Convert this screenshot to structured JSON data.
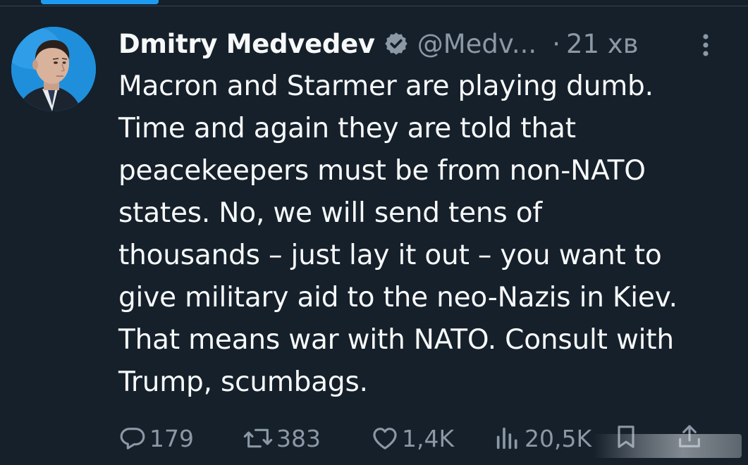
{
  "tweet": {
    "author": {
      "display_name": "Dmitry Medvedev",
      "handle": "@Medv...",
      "verified": true,
      "avatar_icon": "avatar-portrait"
    },
    "separator": "·",
    "time": "21 хв",
    "more_icon": "more-vertical-icon",
    "text": "Macron and Starmer are playing dumb.\nTime and again they are told that\npeacekeepers must be from non-NATO\nstates. No, we will send tens of\nthousands – just lay it out – you want to\ngive military aid to the neo-Nazis in Kiev.\nThat means war with NATO. Consult with\nTrump, scumbags.",
    "actions": {
      "reply": {
        "icon": "reply-icon",
        "count": "179"
      },
      "retweet": {
        "icon": "retweet-icon",
        "count": "383"
      },
      "like": {
        "icon": "heart-icon",
        "count": "1,4K"
      },
      "views": {
        "icon": "views-icon",
        "count": "20,5K"
      },
      "bookmark": {
        "icon": "bookmark-icon"
      },
      "share": {
        "icon": "share-icon"
      }
    }
  },
  "colors": {
    "background": "#15202b",
    "text": "#f7f9f9",
    "muted": "#8b98a5",
    "accent": "#1d9bf0",
    "divider": "#38444d"
  }
}
